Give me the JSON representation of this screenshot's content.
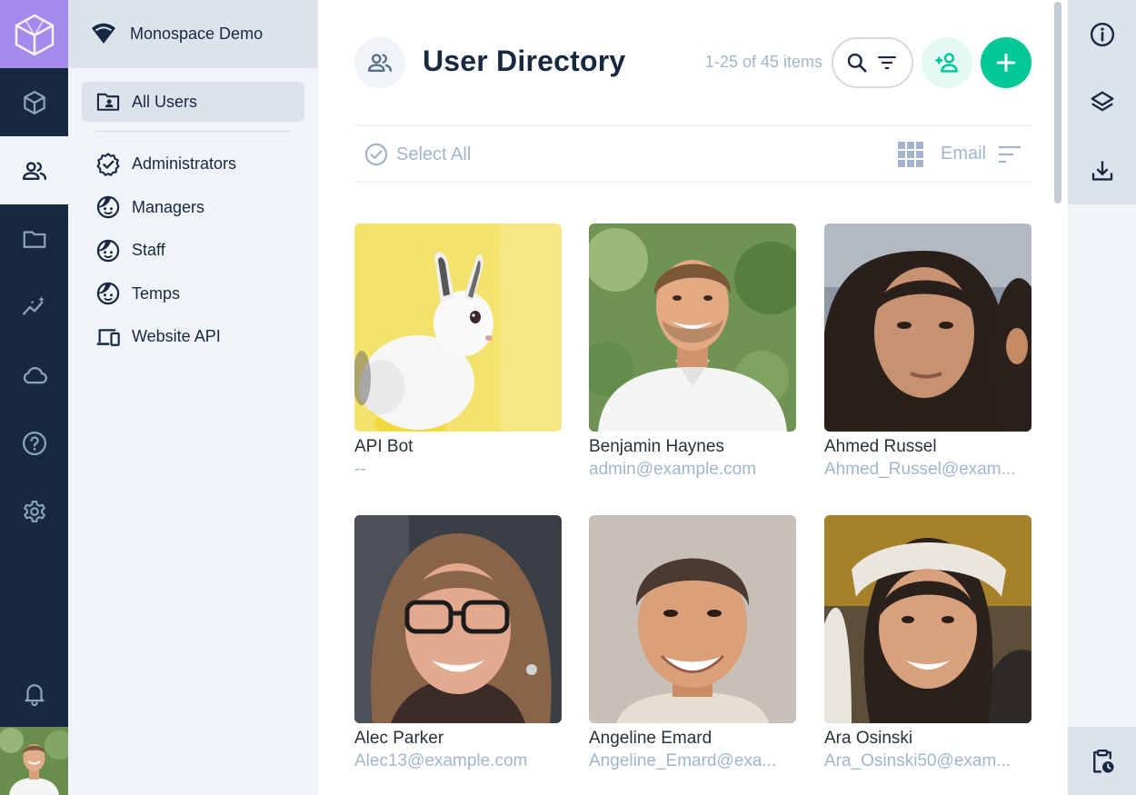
{
  "project": {
    "name": "Monospace Demo"
  },
  "modules": [
    {
      "name": "content",
      "icon": "cube-icon",
      "active": false
    },
    {
      "name": "users",
      "icon": "people-icon",
      "active": true
    },
    {
      "name": "files",
      "icon": "folder-icon",
      "active": false
    },
    {
      "name": "insights",
      "icon": "insights-icon",
      "active": false
    },
    {
      "name": "cloud",
      "icon": "cloud-icon",
      "active": false
    },
    {
      "name": "help",
      "icon": "help-icon",
      "active": false
    },
    {
      "name": "settings",
      "icon": "gear-icon",
      "active": false
    }
  ],
  "sidebar": {
    "items": [
      {
        "label": "All Users",
        "icon": "folder-user-icon",
        "active": true
      },
      {
        "label": "Administrators",
        "icon": "verified-badge-icon"
      },
      {
        "label": "Managers",
        "icon": "face-icon"
      },
      {
        "label": "Staff",
        "icon": "face-icon"
      },
      {
        "label": "Temps",
        "icon": "face-icon"
      },
      {
        "label": "Website API",
        "icon": "devices-icon"
      }
    ]
  },
  "header": {
    "title": "User Directory",
    "count": "1-25 of 45 items"
  },
  "toolbar": {
    "select_all": "Select All",
    "sort_field": "Email"
  },
  "users": [
    {
      "name": "API Bot",
      "email": "--"
    },
    {
      "name": "Benjamin Haynes",
      "email": "admin@example.com"
    },
    {
      "name": "Ahmed Russel",
      "email": "Ahmed_Russel@exam..."
    },
    {
      "name": "Alec Parker",
      "email": "Alec13@example.com"
    },
    {
      "name": "Angeline Emard",
      "email": "Angeline_Emard@exa..."
    },
    {
      "name": "Ara Osinski",
      "email": "Ara_Osinski50@exam..."
    }
  ],
  "colors": {
    "module_bar": "#172940",
    "logo_bg": "#a38aeb",
    "accent": "#00c897",
    "muted_text": "#a2b5cd"
  },
  "right_panel": [
    "info-icon",
    "layers-icon",
    "download-icon",
    "clipboard-clock-icon"
  ]
}
